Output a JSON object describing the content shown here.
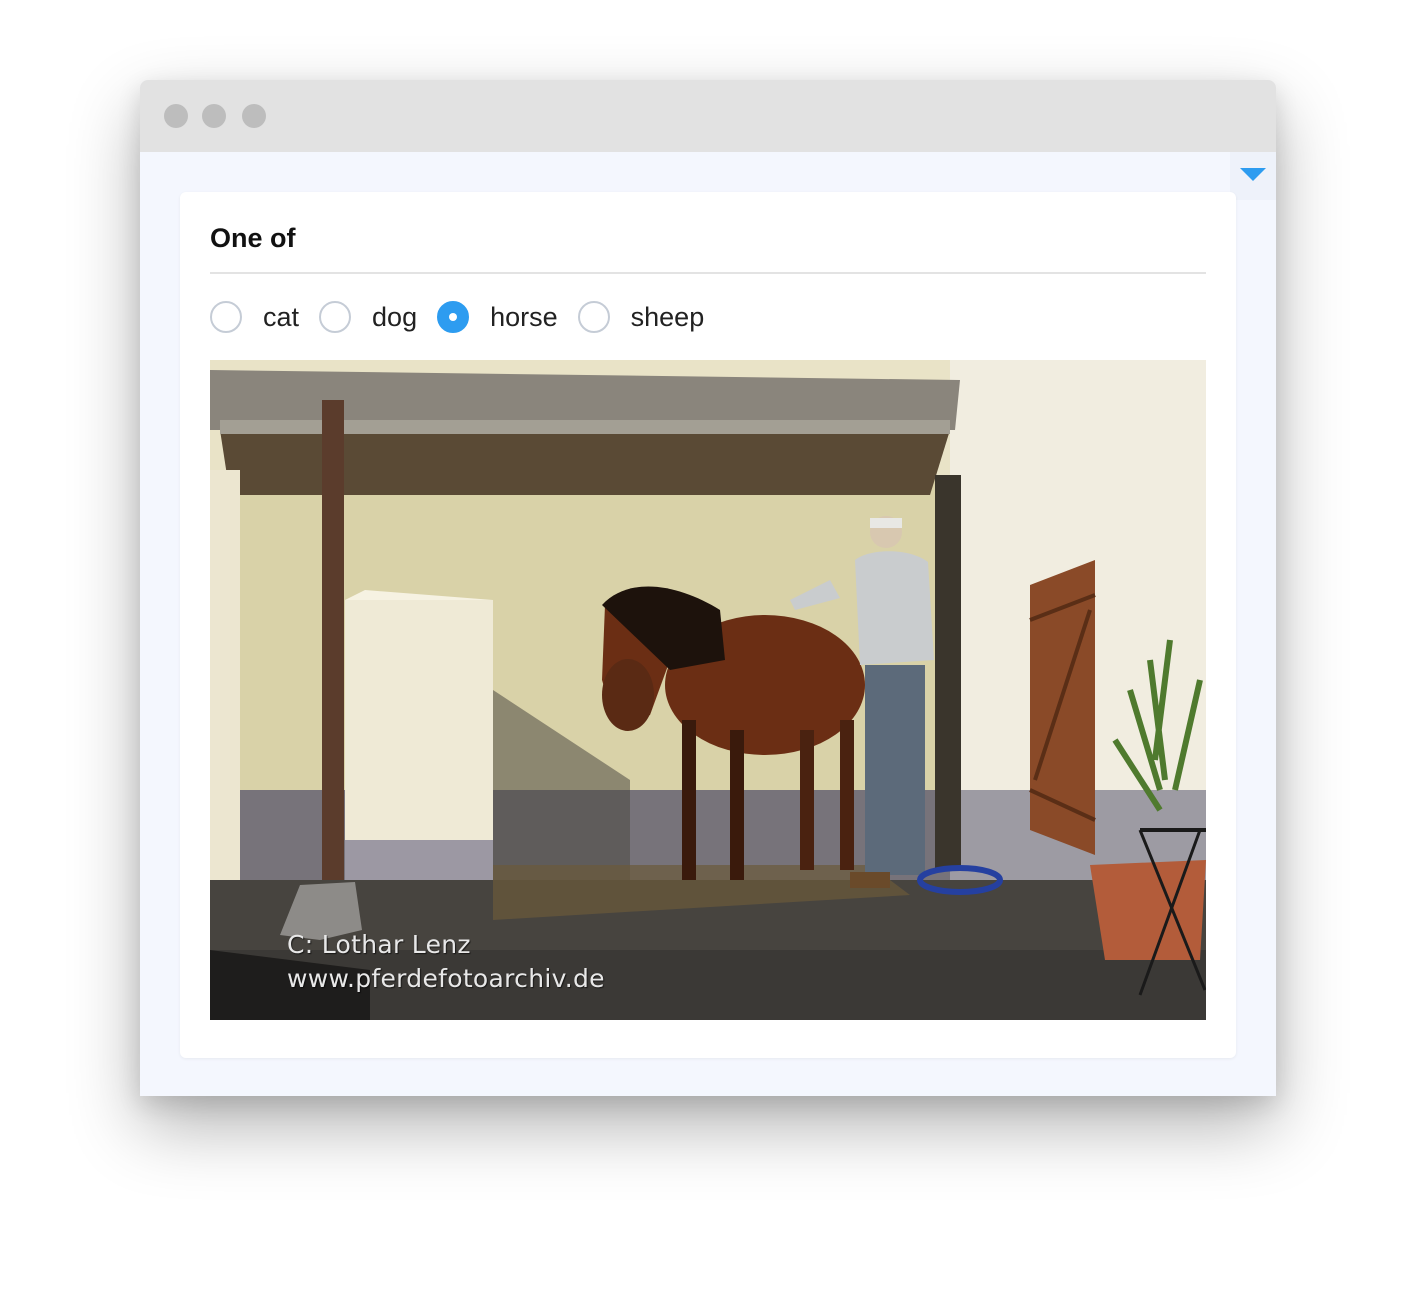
{
  "window": {
    "traffic_lights": [
      {
        "name": "close",
        "color": "#bdbdbd"
      },
      {
        "name": "minimize",
        "color": "#bdbdbd"
      },
      {
        "name": "maximize",
        "color": "#bdbdbd"
      }
    ]
  },
  "menu": {
    "icon": "caret-down-icon",
    "color": "#2d9cf0"
  },
  "question": {
    "title": "One of",
    "choices": [
      {
        "label": "cat",
        "selected": false
      },
      {
        "label": "dog",
        "selected": false
      },
      {
        "label": "horse",
        "selected": true
      },
      {
        "label": "sheep",
        "selected": false
      }
    ],
    "accent_color": "#2d9cf0"
  },
  "image": {
    "subject": "horse",
    "watermark_line1": "C:   Lothar Lenz",
    "watermark_line2": "www.pferdefotoarchiv.de"
  }
}
